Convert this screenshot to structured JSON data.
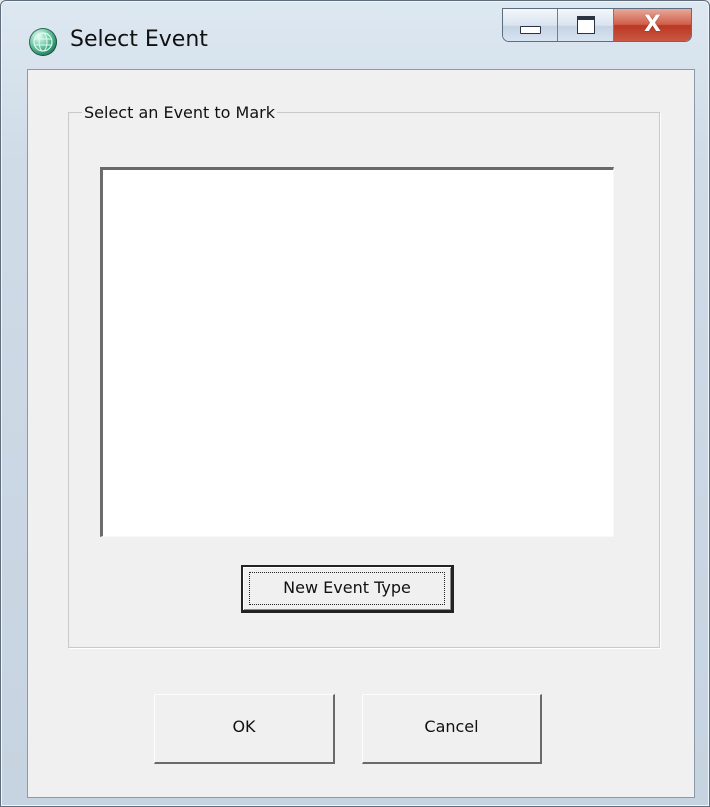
{
  "window": {
    "title": "Select Event",
    "icon": "globe-icon",
    "caption_buttons": {
      "minimize_icon": "minimize-icon",
      "maximize_icon": "maximize-icon",
      "close_icon": "close-icon",
      "close_glyph": "X"
    }
  },
  "group": {
    "label": "Select an Event to Mark"
  },
  "event_list": {
    "items": []
  },
  "buttons": {
    "new_event_type": "New Event Type",
    "ok": "OK",
    "cancel": "Cancel"
  },
  "colors": {
    "close_button": "#c94a36",
    "dialog_background": "#f0f0f0",
    "list_background": "#ffffff"
  }
}
